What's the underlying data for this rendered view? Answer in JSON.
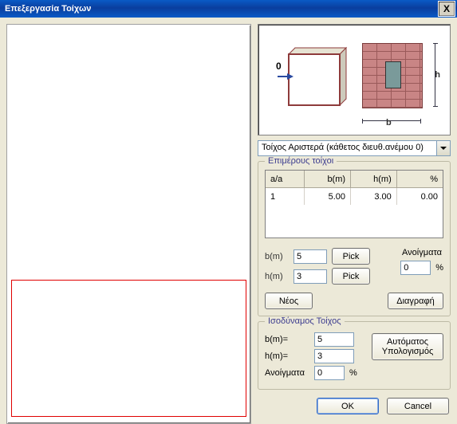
{
  "title": "Επεξεργασία Τοίχων",
  "close_x": "X",
  "diagram": {
    "zero": "0",
    "h": "h",
    "b": "b"
  },
  "combo": {
    "selected": "Τοίχος Αριστερά (κάθετος διευθ.ανέμου 0)"
  },
  "group_sub": {
    "legend": "Επιμέρους τοίχοι",
    "cols": {
      "aa": "a/a",
      "bm": "b(m)",
      "hm": "h(m)",
      "pct": "%"
    },
    "row": {
      "aa": "1",
      "bm": "5.00",
      "hm": "3.00",
      "pct": "0.00"
    },
    "lbl_bm": "b(m)",
    "lbl_hm": "h(m)",
    "val_bm": "5",
    "val_hm": "3",
    "pick": "Pick",
    "anoigmata": "Ανοίγματα",
    "an_val": "0",
    "pct_sym": "%",
    "new_btn": "Νέος",
    "del_btn": "Διαγραφή"
  },
  "group_eq": {
    "legend": "Ισοδύναμος Τοίχος",
    "lbl_bm": "b(m)=",
    "lbl_hm": "h(m)=",
    "lbl_an": "Ανοίγματα",
    "val_bm": "5",
    "val_hm": "3",
    "val_an": "0",
    "pct_sym": "%",
    "auto_btn": "Αυτόματος\nΥπολογισμός"
  },
  "ok": "OK",
  "cancel": "Cancel"
}
